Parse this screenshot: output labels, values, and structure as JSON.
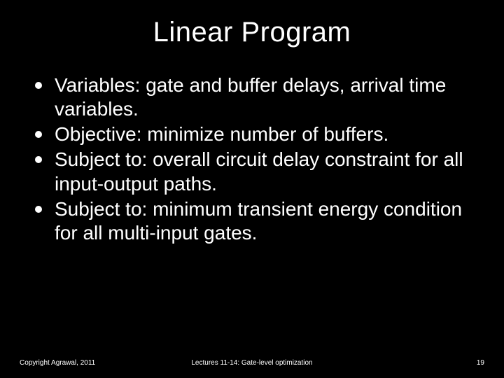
{
  "title": "Linear Program",
  "bullets": [
    "Variables: gate and buffer delays, arrival time variables.",
    "Objective: minimize number of buffers.",
    "Subject to: overall circuit delay constraint for all input-output paths.",
    "Subject to: minimum transient energy condition for all multi-input gates."
  ],
  "footer": {
    "left": "Copyright Agrawal, 2011",
    "center": "Lectures 11-14: Gate-level optimization",
    "right": "19"
  }
}
